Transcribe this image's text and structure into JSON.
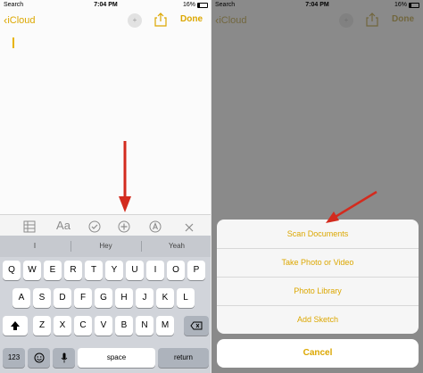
{
  "status_bar": {
    "carrier": "Search",
    "time": "7:04 PM",
    "battery": "16%"
  },
  "nav": {
    "back_label": "iCloud",
    "done_label": "Done"
  },
  "toolbar": {
    "items": [
      "table-icon",
      "Aa",
      "checklist-icon",
      "plus-icon",
      "sketch-icon",
      "close-icon"
    ],
    "text_style": "Aa"
  },
  "keyboard": {
    "suggestions": [
      "I",
      "Hey",
      "Yeah"
    ],
    "row1": [
      "Q",
      "W",
      "E",
      "R",
      "T",
      "Y",
      "U",
      "I",
      "O",
      "P"
    ],
    "row2": [
      "A",
      "S",
      "D",
      "F",
      "G",
      "H",
      "J",
      "K",
      "L"
    ],
    "row3": [
      "Z",
      "X",
      "C",
      "V",
      "B",
      "N",
      "M"
    ],
    "numbers_key": "123",
    "space_key": "space",
    "return_key": "return"
  },
  "action_sheet": {
    "options": [
      "Scan Documents",
      "Take Photo or Video",
      "Photo Library",
      "Add Sketch"
    ],
    "cancel": "Cancel"
  },
  "colors": {
    "accent": "#dca700",
    "arrow": "#d32b1e",
    "dim_overlay": "#8a8a8a"
  }
}
